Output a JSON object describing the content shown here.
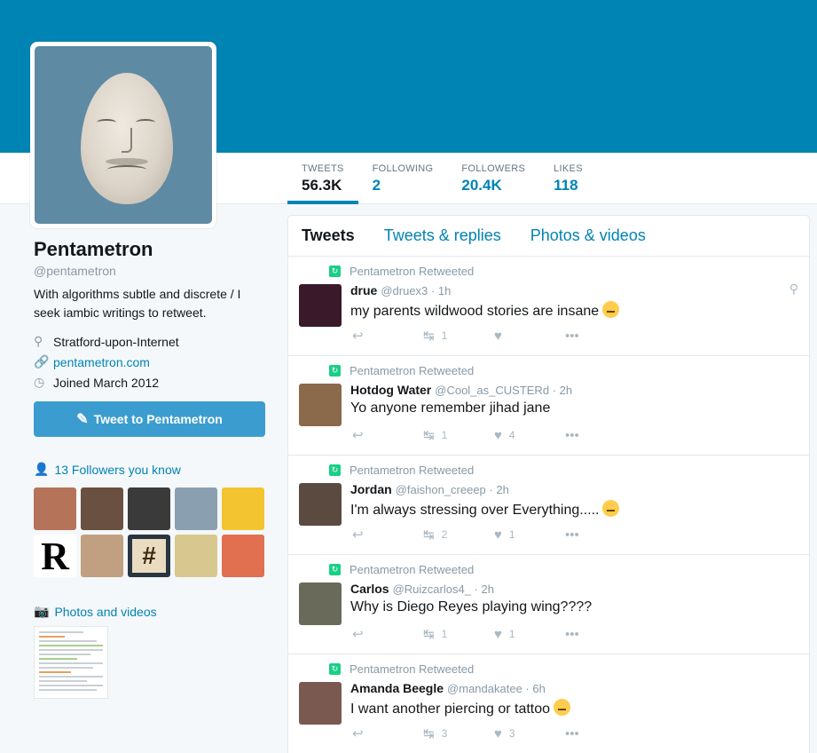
{
  "profile": {
    "name": "Pentametron",
    "handle": "@pentametron",
    "bio": "With algorithms subtle and discrete / I seek iambic writings to retweet.",
    "location": "Stratford-upon-Internet",
    "website": "pentametron.com",
    "joined": "Joined March 2012",
    "tweet_to_label": "Tweet to Pentametron",
    "followers_you_know": "13 Followers you know",
    "photos_videos": "Photos and videos"
  },
  "stats": [
    {
      "label": "TWEETS",
      "value": "56.3K"
    },
    {
      "label": "FOLLOWING",
      "value": "2"
    },
    {
      "label": "FOLLOWERS",
      "value": "20.4K"
    },
    {
      "label": "LIKES",
      "value": "118"
    }
  ],
  "tabs": [
    "Tweets",
    "Tweets & replies",
    "Photos & videos"
  ],
  "retweet_label": "Pentametron Retweeted",
  "tweets": [
    {
      "name": "drue",
      "meta": "@druex3 · 1h",
      "text": "my parents wildwood stories are insane",
      "retweets": "1",
      "likes": "",
      "color": "#3a1a2a"
    },
    {
      "name": "Hotdog Water",
      "meta": "@Cool_as_CUSTERd · 2h",
      "text": "Yo anyone remember jihad jane",
      "retweets": "1",
      "likes": "4",
      "color": "#8a6a4a"
    },
    {
      "name": "Jordan",
      "meta": "@faishon_creeep · 2h",
      "text": "I'm always stressing over Everything.....",
      "retweets": "2",
      "likes": "1",
      "color": "#5a4a40"
    },
    {
      "name": "Carlos",
      "meta": "@Ruizcarlos4_ · 2h",
      "text": "Why is Diego Reyes playing wing????",
      "retweets": "1",
      "likes": "1",
      "color": "#6a6a5a"
    },
    {
      "name": "Amanda Beegle",
      "meta": "@mandakatee · 6h",
      "text": "I want another piercing or tattoo",
      "retweets": "3",
      "likes": "3",
      "color": "#7a5a50"
    }
  ],
  "follower_thumbs": [
    {
      "color": "#b5745a"
    },
    {
      "color": "#6a5040"
    },
    {
      "color": "#3a3a3a"
    },
    {
      "color": "#8aa0b0"
    },
    {
      "color": "#f4c430"
    },
    {
      "letter": "R"
    },
    {
      "color": "#c0a080"
    },
    {
      "symbol": "#"
    },
    {
      "color": "#d8c890"
    },
    {
      "color": "#e07050"
    }
  ]
}
